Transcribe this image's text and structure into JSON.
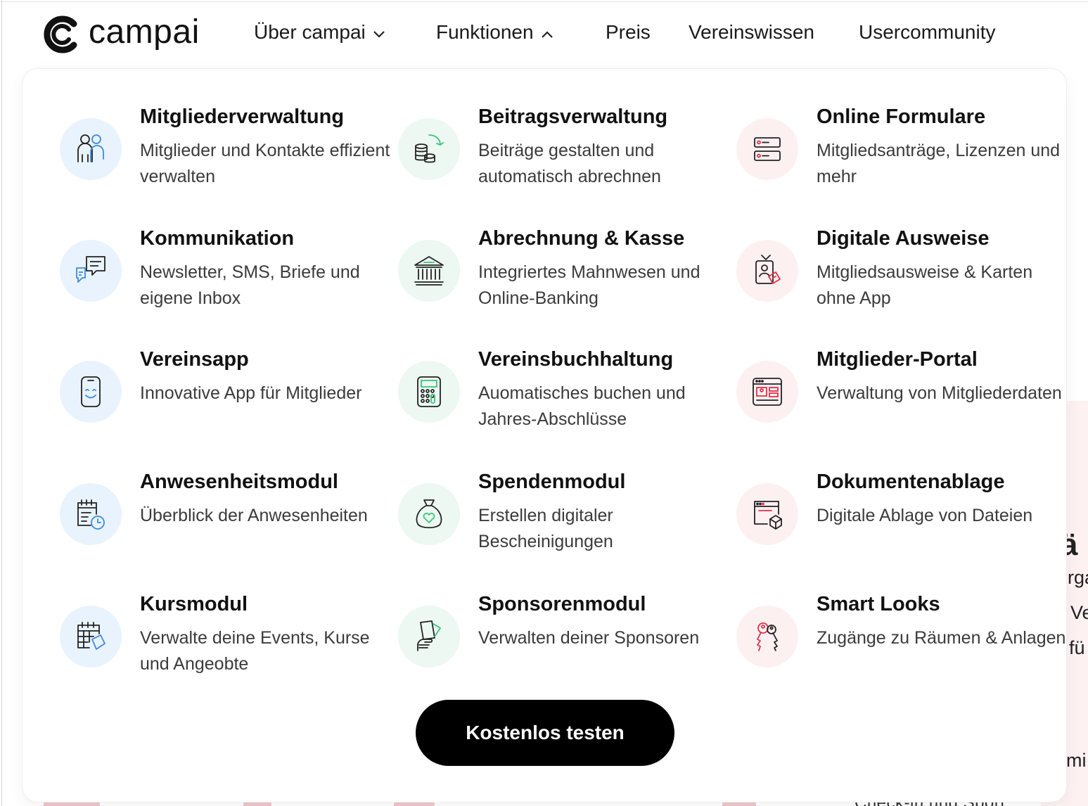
{
  "brand": {
    "name": "campai"
  },
  "nav": {
    "items": [
      {
        "label": "Über campai",
        "chevron": "chevron-down-icon"
      },
      {
        "label": "Funktionen",
        "chevron": "chevron-up-icon"
      },
      {
        "label": "Preis"
      },
      {
        "label": "Vereinswissen"
      },
      {
        "label": "Usercommunity"
      }
    ]
  },
  "menu": {
    "columns": [
      [
        {
          "title": "Mitgliederverwaltung",
          "desc": "Mitglieder und Kontakte effizient verwalten",
          "icon": "people-icon",
          "color": "#e9f3fd"
        },
        {
          "title": "Kommunikation",
          "desc": "Newsletter, SMS, Briefe und eigene Inbox",
          "icon": "chat-bubbles-icon",
          "color": "#e9f3fd"
        },
        {
          "title": "Vereinsapp",
          "desc": "Innovative App für Mitglieder",
          "icon": "smartphone-icon",
          "color": "#e9f3fd"
        },
        {
          "title": "Anwesenheitsmodul",
          "desc": "Überblick der Anwesenheiten",
          "icon": "calendar-clock-icon",
          "color": "#e9f3fd"
        },
        {
          "title": "Kursmodul",
          "desc": "Verwalte deine Events, Kurse und Angeobte",
          "icon": "calendar-tag-icon",
          "color": "#e9f3fd"
        }
      ],
      [
        {
          "title": "Beitragsverwaltung",
          "desc": "Beiträge gestalten und automatisch abrechnen",
          "icon": "coins-arrow-icon",
          "color": "#ecf8f1"
        },
        {
          "title": "Abrechnung & Kasse",
          "desc": "Integriertes Mahnwesen und Online-Banking",
          "icon": "bank-icon",
          "color": "#ecf8f1"
        },
        {
          "title": "Vereinsbuchhaltung",
          "desc": "Auomatisches buchen und Jahres-Abschlüsse",
          "icon": "calculator-icon",
          "color": "#ecf8f1"
        },
        {
          "title": "Spendenmodul",
          "desc": "Erstellen digitaler Bescheinigungen",
          "icon": "money-bag-heart-icon",
          "color": "#ecf8f1"
        },
        {
          "title": "Sponsorenmodul",
          "desc": "Verwalten deiner Sponsoren",
          "icon": "hand-card-icon",
          "color": "#ecf8f1"
        }
      ],
      [
        {
          "title": "Online Formulare",
          "desc": "Mitgliedsanträge, Lizenzen und mehr",
          "icon": "form-fields-icon",
          "color": "#fdf0f1"
        },
        {
          "title": "Digitale Ausweise",
          "desc": "Mitgliedsausweise & Karten ohne App",
          "icon": "id-badge-icon",
          "color": "#fdf0f1"
        },
        {
          "title": "Mitglieder-Portal",
          "desc": "Verwaltung von Mitgliederdaten",
          "icon": "browser-portal-icon",
          "color": "#fdf0f1"
        },
        {
          "title": "Dokumentenablage",
          "desc": "Digitale Ablage von Dateien",
          "icon": "browser-box-icon",
          "color": "#fdf0f1"
        },
        {
          "title": "Smart Looks",
          "desc": "Zugänge zu Räumen & Anlagen",
          "icon": "keys-icon",
          "color": "#fdf0f1"
        }
      ]
    ],
    "cta_label": "Kostenlos testen"
  },
  "background": {
    "fragments": [
      "' ä",
      "rga",
      "Ve",
      "fü",
      "mi"
    ],
    "bottom_text": "Check-in und Sport"
  },
  "colors": {
    "accent": "#000000",
    "icon_stroke": "#222222",
    "green_accent": "#3cc47c",
    "red_accent": "#e0314b",
    "blue_bg": "#e9f3fd",
    "green_bg": "#ecf8f1",
    "red_bg": "#fdf0f1"
  }
}
